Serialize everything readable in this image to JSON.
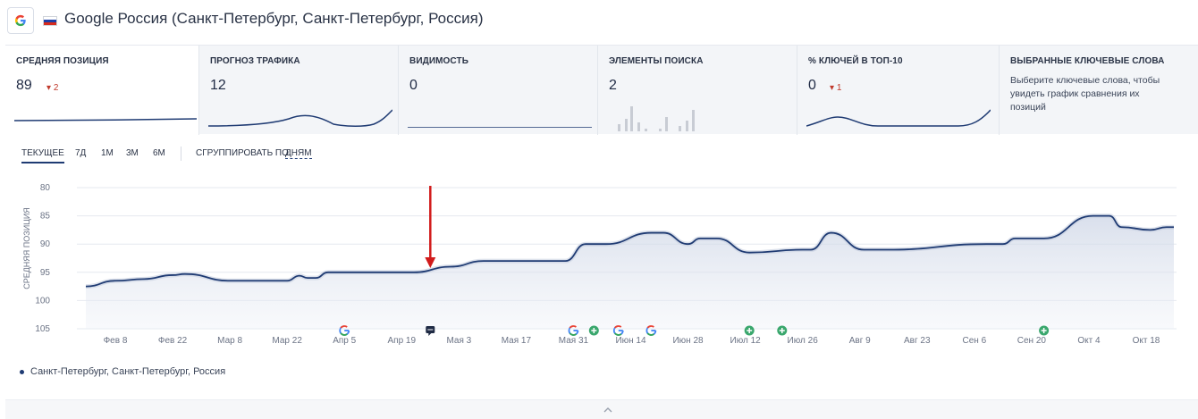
{
  "header": {
    "logo_icon": "google-g-icon",
    "flag_icon": "russia-flag-icon",
    "title": "Google Россия (Санкт-Петербург, Санкт-Петербург, Россия)"
  },
  "metrics": [
    {
      "label": "СРЕДНЯЯ ПОЗИЦИЯ",
      "value": "89",
      "delta": "2",
      "delta_icon": "arrow-down-icon"
    },
    {
      "label": "ПРОГНОЗ ТРАФИКА",
      "value": "12"
    },
    {
      "label": "ВИДИМОСТЬ",
      "value": "0"
    },
    {
      "label": "ЭЛЕМЕНТЫ ПОИСКА",
      "value": "2"
    },
    {
      "label": "% КЛЮЧЕЙ В ТОП-10",
      "value": "0",
      "delta": "1",
      "delta_icon": "arrow-down-icon"
    },
    {
      "label": "ВЫБРАННЫЕ КЛЮЧЕВЫЕ СЛОВА",
      "description": "Выберите ключевые слова, чтобы увидеть график сравнения их позиций"
    }
  ],
  "controls": {
    "periods": [
      "ТЕКУЩЕЕ",
      "7Д",
      "1М",
      "3М",
      "6М"
    ],
    "active_period": "ТЕКУЩЕЕ",
    "group_label": "СГРУППИРОВАТЬ ПО:",
    "group_value": "ДНЯМ"
  },
  "chart_data": {
    "type": "area",
    "ylabel": "СРЕДНЯЯ ПОЗИЦИЯ",
    "y_ticks": [
      80,
      85,
      90,
      95,
      100,
      105
    ],
    "ylim": [
      105,
      80
    ],
    "y_inverted": true,
    "x_ticks": [
      "Фев 8",
      "Фев 22",
      "Мар 8",
      "Мар 22",
      "Апр 5",
      "Апр 19",
      "Мая 3",
      "Мая 17",
      "Мая 31",
      "Июн 14",
      "Июн 28",
      "Июл 12",
      "Июл 26",
      "Авг 9",
      "Авг 23",
      "Сен 6",
      "Сен 20",
      "Окт 4",
      "Окт 18"
    ],
    "grid": true,
    "series": [
      {
        "name": "Санкт-Петербург, Санкт-Петербург, Россия",
        "color": "#1f3b73",
        "x": [
          "Фев 1",
          "Фев 8",
          "Фев 15",
          "Фев 22",
          "Фев 25",
          "Мар 8",
          "Мар 22",
          "Мар 25",
          "Мар 27",
          "Мар 29",
          "Апр 1",
          "Апр 22",
          "Мая 1",
          "Мая 9",
          "Мая 29",
          "Июн 3",
          "Июн 8",
          "Июн 19",
          "Июн 22",
          "Июн 28",
          "Июл 1",
          "Июл 5",
          "Июл 13",
          "Июл 26",
          "Июл 28",
          "Авг 2",
          "Авг 10",
          "Авг 16",
          "Сен 9",
          "Сен 13",
          "Сен 16",
          "Сен 23",
          "Окт 5",
          "Окт 9",
          "Окт 12",
          "Окт 19",
          "Окт 23"
        ],
        "y": [
          97.5,
          96.5,
          96.2,
          95.5,
          95.3,
          96.5,
          96.5,
          95.6,
          96.0,
          96.0,
          95.0,
          95.0,
          94.0,
          93.0,
          93.0,
          90.0,
          90.0,
          88.0,
          88.0,
          90.0,
          89.0,
          89.0,
          91.5,
          91.0,
          91.0,
          88.0,
          91.0,
          91.0,
          90.0,
          90.0,
          89.0,
          89.0,
          85.0,
          85.0,
          87.0,
          87.5,
          87.0
        ]
      }
    ],
    "events": [
      {
        "date": "Апр 5",
        "icon": "google-update-icon"
      },
      {
        "date": "Апр 26",
        "icon": "note-icon"
      },
      {
        "date": "Мая 31",
        "icon": "google-update-icon"
      },
      {
        "date": "Июн 5",
        "icon": "plus-event-icon"
      },
      {
        "date": "Июн 11",
        "icon": "google-update-icon"
      },
      {
        "date": "Июн 19",
        "icon": "google-update-icon"
      },
      {
        "date": "Июл 13",
        "icon": "plus-event-icon"
      },
      {
        "date": "Июл 21",
        "icon": "plus-event-icon"
      },
      {
        "date": "Сен 23",
        "icon": "plus-event-icon"
      }
    ],
    "annotation": {
      "date": "Апр 26",
      "icon": "red-arrow-down-icon"
    }
  },
  "legend": {
    "label": "Санкт-Петербург, Санкт-Петербург, Россия"
  },
  "bottom": {
    "collapse_icon": "chevron-up-icon"
  }
}
